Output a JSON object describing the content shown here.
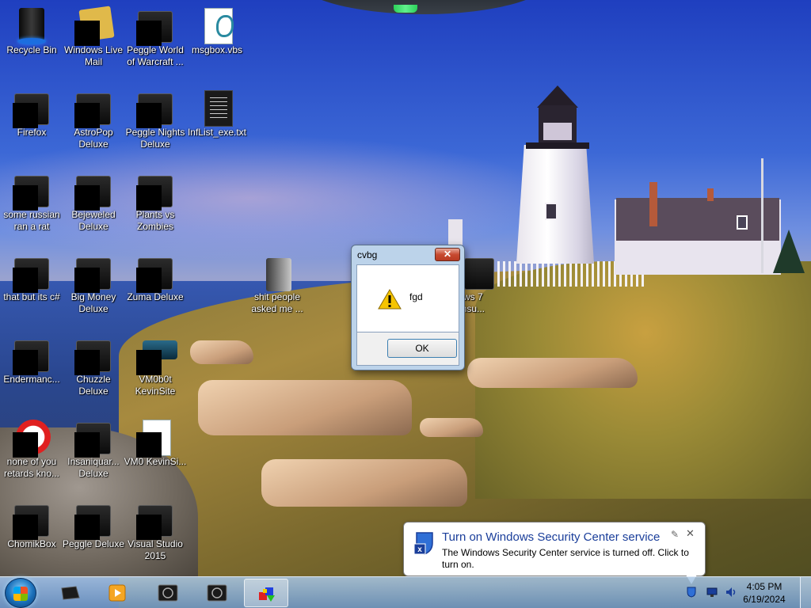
{
  "desktop": {
    "icons": [
      {
        "label": "Recycle Bin",
        "icon": "recycle-bin-icon"
      },
      {
        "label": "Windows Live Mail",
        "icon": "mail-icon"
      },
      {
        "label": "Peggle World of Warcraft ...",
        "icon": "app-shortcut-icon"
      },
      {
        "label": "msgbox.vbs",
        "icon": "vbs-script-icon"
      },
      {
        "label": "Firefox",
        "icon": "app-shortcut-icon"
      },
      {
        "label": "AstroPop Deluxe",
        "icon": "app-shortcut-icon"
      },
      {
        "label": "Peggle Nights Deluxe",
        "icon": "app-shortcut-icon"
      },
      {
        "label": "InfList_exe.txt",
        "icon": "text-file-icon"
      },
      {
        "label": "some russian ran a rat",
        "icon": "app-shortcut-icon"
      },
      {
        "label": "Bejeweled Deluxe",
        "icon": "app-shortcut-icon"
      },
      {
        "label": "Plants vs Zombies",
        "icon": "app-shortcut-icon"
      },
      {
        "label": "that but its c#",
        "icon": "app-shortcut-icon"
      },
      {
        "label": "Big Money Deluxe",
        "icon": "app-shortcut-icon"
      },
      {
        "label": "Zuma Deluxe",
        "icon": "app-shortcut-icon"
      },
      {
        "label": "shit people asked me ...",
        "icon": "folder-icon"
      },
      {
        "label": "ows 7 .msu...",
        "icon": "app-shortcut-icon"
      },
      {
        "label": "Endermanc...",
        "icon": "app-shortcut-icon"
      },
      {
        "label": "Chuzzle Deluxe",
        "icon": "app-shortcut-icon"
      },
      {
        "label": "VM0b0t KevinSite",
        "icon": "drive-icon"
      },
      {
        "label": "none of you retards kno...",
        "icon": "app-shortcut-icon"
      },
      {
        "label": "Insaniquar... Deluxe",
        "icon": "app-shortcut-icon"
      },
      {
        "label": "VM0 KevinSi...",
        "icon": "document-icon"
      },
      {
        "label": "ChomikBox",
        "icon": "app-shortcut-icon"
      },
      {
        "label": "Peggle Deluxe",
        "icon": "app-shortcut-icon"
      },
      {
        "label": "Visual Studio 2015",
        "icon": "app-shortcut-icon"
      }
    ]
  },
  "dialog": {
    "title": "cvbg",
    "close_glyph": "✕",
    "message": "fgd",
    "ok_label": "OK",
    "icon": "warning-icon"
  },
  "notification": {
    "title": "Turn on Windows Security Center service",
    "text": "The Windows Security Center service is turned off. Click to turn on.",
    "icon": "security-shield-icon",
    "close_glyph": "✕",
    "pin_glyph": "✎"
  },
  "taskbar": {
    "pinned": [
      {
        "name": "media-center-icon"
      },
      {
        "name": "media-player-icon"
      },
      {
        "name": "app-window-icon"
      },
      {
        "name": "app-window-icon"
      },
      {
        "name": "paint-app-icon",
        "active": true
      }
    ],
    "clock": {
      "time": "4:05 PM",
      "date": "6/19/2024"
    }
  },
  "colors": {
    "balloon_title": "#1a3e9a",
    "dialog_frame": "#bcd3ea",
    "taskbar": "#8fb0d4"
  }
}
